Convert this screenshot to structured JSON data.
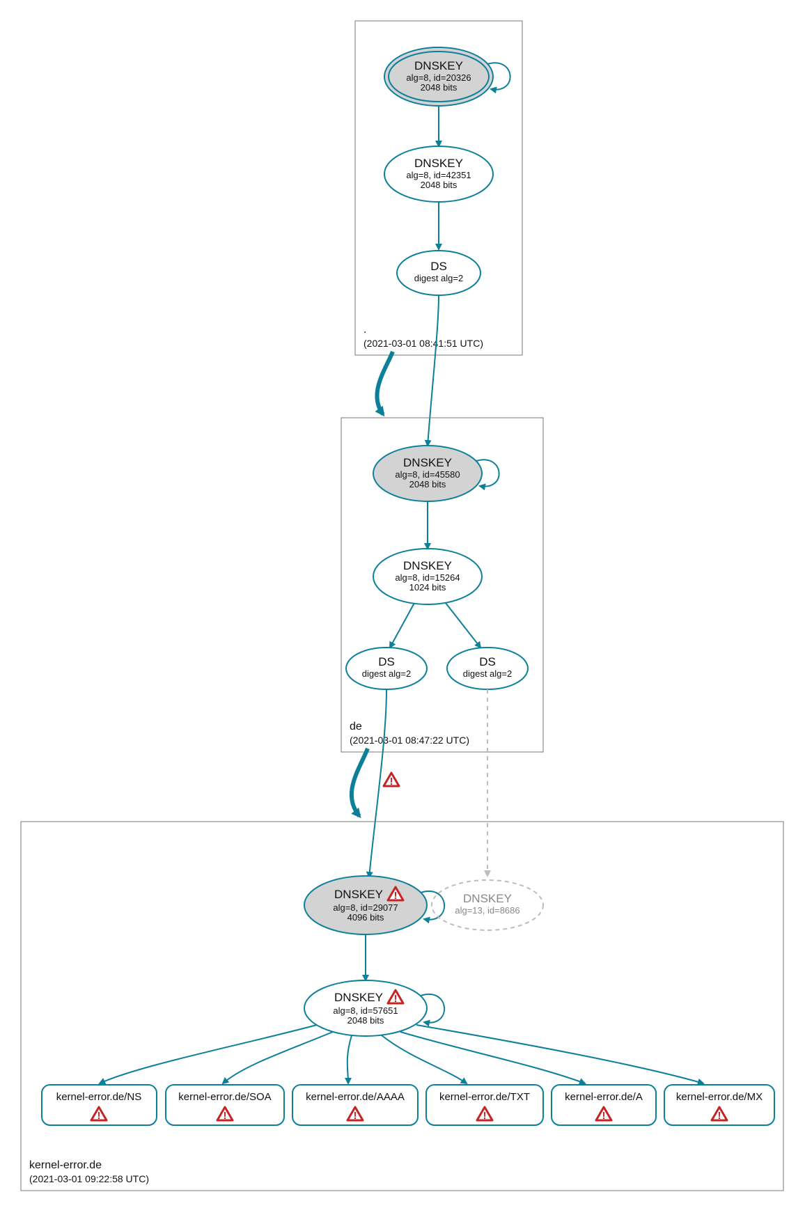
{
  "colors": {
    "accent": "#0c7f99",
    "warn": "#c62424",
    "node_grey": "#d3d3d3",
    "muted": "#bdbdbd"
  },
  "zones": {
    "root": {
      "label": ".",
      "date": "(2021-03-01 08:41:51 UTC)"
    },
    "de": {
      "label": "de",
      "date": "(2021-03-01 08:47:22 UTC)"
    },
    "ke": {
      "label": "kernel-error.de",
      "date": "(2021-03-01 09:22:58 UTC)"
    }
  },
  "nodes": {
    "root_ksk": {
      "title": "DNSKEY",
      "l2": "alg=8, id=20326",
      "l3": "2048 bits"
    },
    "root_zsk": {
      "title": "DNSKEY",
      "l2": "alg=8, id=42351",
      "l3": "2048 bits"
    },
    "root_ds": {
      "title": "DS",
      "l2": "digest alg=2"
    },
    "de_ksk": {
      "title": "DNSKEY",
      "l2": "alg=8, id=45580",
      "l3": "2048 bits"
    },
    "de_zsk": {
      "title": "DNSKEY",
      "l2": "alg=8, id=15264",
      "l3": "1024 bits"
    },
    "de_ds1": {
      "title": "DS",
      "l2": "digest alg=2"
    },
    "de_ds2": {
      "title": "DS",
      "l2": "digest alg=2"
    },
    "ke_ksk": {
      "title": "DNSKEY",
      "l2": "alg=8, id=29077",
      "l3": "4096 bits"
    },
    "ke_zsk": {
      "title": "DNSKEY",
      "l2": "alg=8, id=57651",
      "l3": "2048 bits"
    },
    "ke_dash": {
      "title": "DNSKEY",
      "l2": "alg=13, id=8686"
    },
    "rr_ns": {
      "label": "kernel-error.de/NS"
    },
    "rr_soa": {
      "label": "kernel-error.de/SOA"
    },
    "rr_aaaa": {
      "label": "kernel-error.de/AAAA"
    },
    "rr_txt": {
      "label": "kernel-error.de/TXT"
    },
    "rr_a": {
      "label": "kernel-error.de/A"
    },
    "rr_mx": {
      "label": "kernel-error.de/MX"
    }
  }
}
